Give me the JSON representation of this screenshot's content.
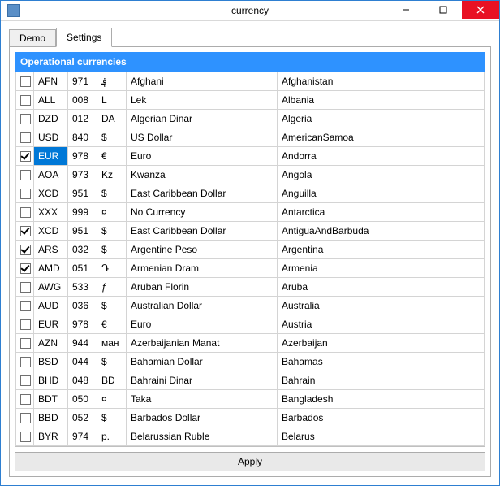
{
  "window": {
    "title": "currency"
  },
  "tabs": {
    "demo": "Demo",
    "settings": "Settings",
    "active": "settings"
  },
  "panel": {
    "header": "Operational currencies",
    "apply_label": "Apply"
  },
  "rows": [
    {
      "checked": false,
      "selected": false,
      "code": "AFN",
      "num": "971",
      "sym": "؋",
      "name": "Afghani",
      "country": "Afghanistan"
    },
    {
      "checked": false,
      "selected": false,
      "code": "ALL",
      "num": "008",
      "sym": "L",
      "name": "Lek",
      "country": "Albania"
    },
    {
      "checked": false,
      "selected": false,
      "code": "DZD",
      "num": "012",
      "sym": "DA",
      "name": "Algerian Dinar",
      "country": "Algeria"
    },
    {
      "checked": false,
      "selected": false,
      "code": "USD",
      "num": "840",
      "sym": "$",
      "name": "US Dollar",
      "country": "AmericanSamoa"
    },
    {
      "checked": true,
      "selected": true,
      "code": "EUR",
      "num": "978",
      "sym": "€",
      "name": "Euro",
      "country": "Andorra"
    },
    {
      "checked": false,
      "selected": false,
      "code": "AOA",
      "num": "973",
      "sym": "Kz",
      "name": "Kwanza",
      "country": "Angola"
    },
    {
      "checked": false,
      "selected": false,
      "code": "XCD",
      "num": "951",
      "sym": "$",
      "name": "East Caribbean Dollar",
      "country": "Anguilla"
    },
    {
      "checked": false,
      "selected": false,
      "code": "XXX",
      "num": "999",
      "sym": "¤",
      "name": "No Currency",
      "country": "Antarctica"
    },
    {
      "checked": true,
      "selected": false,
      "code": "XCD",
      "num": "951",
      "sym": "$",
      "name": "East Caribbean Dollar",
      "country": "AntiguaAndBarbuda"
    },
    {
      "checked": true,
      "selected": false,
      "code": "ARS",
      "num": "032",
      "sym": "$",
      "name": "Argentine Peso",
      "country": "Argentina"
    },
    {
      "checked": true,
      "selected": false,
      "code": "AMD",
      "num": "051",
      "sym": "Դ",
      "name": "Armenian Dram",
      "country": "Armenia"
    },
    {
      "checked": false,
      "selected": false,
      "code": "AWG",
      "num": "533",
      "sym": "ƒ",
      "name": "Aruban Florin",
      "country": "Aruba"
    },
    {
      "checked": false,
      "selected": false,
      "code": "AUD",
      "num": "036",
      "sym": "$",
      "name": "Australian Dollar",
      "country": "Australia"
    },
    {
      "checked": false,
      "selected": false,
      "code": "EUR",
      "num": "978",
      "sym": "€",
      "name": "Euro",
      "country": "Austria"
    },
    {
      "checked": false,
      "selected": false,
      "code": "AZN",
      "num": "944",
      "sym": "ман",
      "name": "Azerbaijanian Manat",
      "country": "Azerbaijan"
    },
    {
      "checked": false,
      "selected": false,
      "code": "BSD",
      "num": "044",
      "sym": "$",
      "name": "Bahamian Dollar",
      "country": "Bahamas"
    },
    {
      "checked": false,
      "selected": false,
      "code": "BHD",
      "num": "048",
      "sym": "BD",
      "name": "Bahraini Dinar",
      "country": "Bahrain"
    },
    {
      "checked": false,
      "selected": false,
      "code": "BDT",
      "num": "050",
      "sym": "¤",
      "name": "Taka",
      "country": "Bangladesh"
    },
    {
      "checked": false,
      "selected": false,
      "code": "BBD",
      "num": "052",
      "sym": "$",
      "name": "Barbados Dollar",
      "country": "Barbados"
    },
    {
      "checked": false,
      "selected": false,
      "code": "BYR",
      "num": "974",
      "sym": "p.",
      "name": "Belarussian Ruble",
      "country": "Belarus"
    }
  ]
}
